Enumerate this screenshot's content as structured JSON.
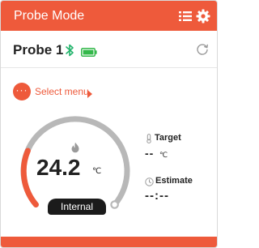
{
  "header": {
    "title": "Probe Mode",
    "list_icon": "list-icon",
    "settings_icon": "gear-icon"
  },
  "probe": {
    "name": "Probe 1",
    "bluetooth_icon": "bluetooth-icon",
    "battery_icon": "battery-icon",
    "refresh_icon": "refresh-icon"
  },
  "menu": {
    "dots": "···",
    "label": "Select menu"
  },
  "gauge": {
    "temperature": "24.2",
    "unit": "℃",
    "sensor_label": "Internal",
    "flame_icon": "flame-icon"
  },
  "target": {
    "label": "Target",
    "value": "--",
    "unit": "℃"
  },
  "estimate": {
    "label": "Estimate",
    "value": "--:--"
  },
  "colors": {
    "accent": "#ee5a3b",
    "gauge_track": "#b8b8b8",
    "bluetooth": "#22b36b",
    "battery": "#33b84a",
    "pill": "#1b1b1b"
  }
}
